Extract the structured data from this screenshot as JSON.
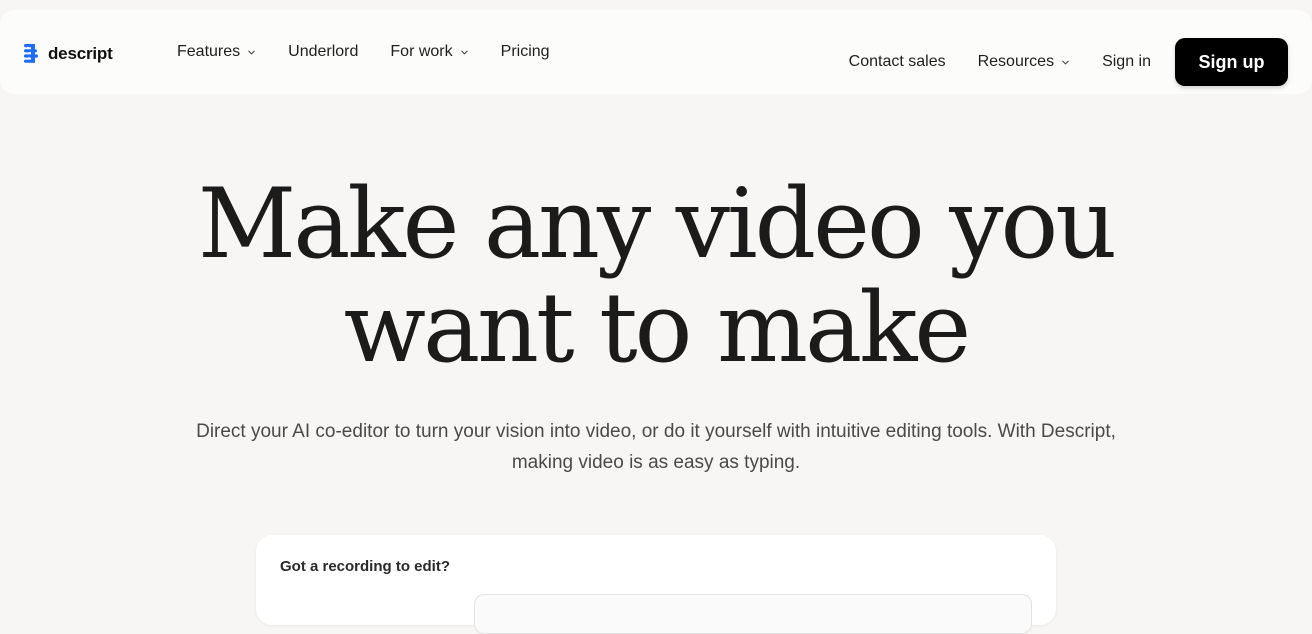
{
  "brand": {
    "name": "descript",
    "accent_color": "#1f6bff"
  },
  "nav": {
    "features": "Features",
    "underlord": "Underlord",
    "for_work": "For work",
    "pricing": "Pricing",
    "contact_sales": "Contact sales",
    "resources": "Resources",
    "sign_in": "Sign in",
    "sign_up": "Sign up"
  },
  "hero": {
    "title_line1": "Make any video you",
    "title_line2": "want to make",
    "subtitle": "Direct your AI co-editor to turn your vision into video, or do it yourself with intuitive editing tools. With Descript, making video is as easy as typing."
  },
  "card": {
    "title": "Got a recording to edit?"
  },
  "icons": {
    "logo": "descript-logo-icon",
    "dropdown": "chevron-down-icon"
  }
}
